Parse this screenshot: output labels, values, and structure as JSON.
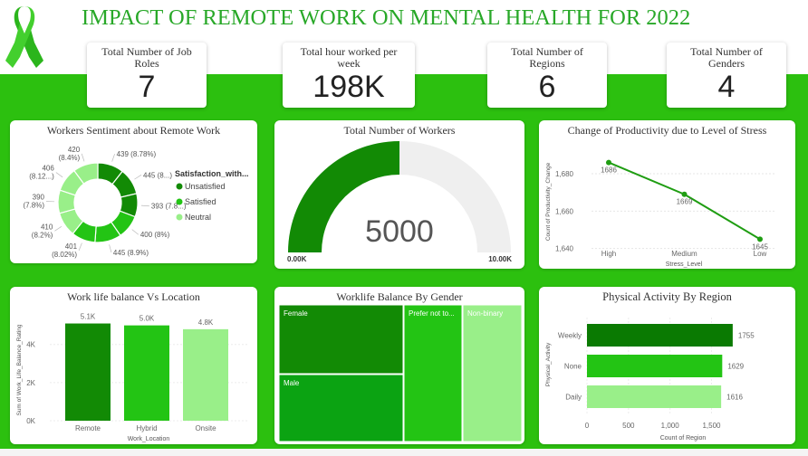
{
  "header": {
    "title": "IMPACT OF REMOTE WORK ON MENTAL HEALTH FOR 2022",
    "ribbon_icon": "awareness-ribbon-icon"
  },
  "kpis": [
    {
      "label": "Total Number of Job Roles",
      "value": "7"
    },
    {
      "label": "Total hour worked per week",
      "value": "198K"
    },
    {
      "label": "Total Number of Regions",
      "value": "6"
    },
    {
      "label": "Total Number of Genders",
      "value": "4"
    }
  ],
  "colors": {
    "dark": "#128a05",
    "mid": "#23c414",
    "light": "#99ef89",
    "darkest": "#0a7a02",
    "line": "#1f9d12",
    "background": "#2cc00f"
  },
  "chart_data": [
    {
      "type": "pie",
      "title": "Workers Sentiment about Remote Work",
      "legend_title": "Satisfaction_with...",
      "legend": [
        "Unsatisfied",
        "Satisfied",
        "Neutral"
      ],
      "slices": [
        {
          "category": "Unsatisfied",
          "value": 439,
          "label": "439 (8.78%)"
        },
        {
          "category": "Unsatisfied",
          "value": 445,
          "label": "445 (8...)"
        },
        {
          "category": "Unsatisfied",
          "value": 393,
          "label": "393 (7.8...)"
        },
        {
          "category": "Satisfied",
          "value": 400,
          "label": "400 (8%)"
        },
        {
          "category": "Satisfied",
          "value": 445,
          "label": "445 (8.9%)"
        },
        {
          "category": "Satisfied",
          "value": 401,
          "label": "401 (8.02%)"
        },
        {
          "category": "Neutral",
          "value": 410,
          "label": "410 (8.2%)"
        },
        {
          "category": "Neutral",
          "value": 390,
          "label": "390 (7.8%)"
        },
        {
          "category": "Neutral",
          "value": 406,
          "label": "406 (8.12...)"
        },
        {
          "category": "Neutral",
          "value": 420,
          "label": "420 (8.4%)"
        }
      ]
    },
    {
      "type": "gauge",
      "title": "Total Number of Workers",
      "value": 5000,
      "value_label": "5000",
      "min": 0,
      "max": 10000,
      "min_label": "0.00K",
      "max_label": "10.00K"
    },
    {
      "type": "line",
      "title": "Change of Productivity due to Level of Stress",
      "categories": [
        "High",
        "Medium",
        "Low"
      ],
      "values": [
        1686,
        1669,
        1645
      ],
      "xlabel": "Stress_Level",
      "ylabel": "Count of Productivity_Change",
      "ylim": [
        1635,
        1695
      ],
      "yticks": [
        1640,
        1660,
        1680
      ],
      "ytick_labels": [
        "1,640",
        "1,660",
        "1,680"
      ]
    },
    {
      "type": "bar",
      "title": "Work life balance Vs Location",
      "categories": [
        "Remote",
        "Hybrid",
        "Onsite"
      ],
      "values": [
        5100,
        5000,
        4800
      ],
      "value_labels": [
        "5.1K",
        "5.0K",
        "4.8K"
      ],
      "xlabel": "Work_Location",
      "ylabel": "Sum of Work_Life_Balance_Rating",
      "ylim": [
        0,
        5600
      ],
      "yticks": [
        0,
        2000,
        4000
      ],
      "ytick_labels": [
        "0K",
        "2K",
        "4K"
      ]
    },
    {
      "type": "treemap",
      "title": "Worklife Balance By Gender",
      "items": [
        {
          "label": "Female"
        },
        {
          "label": "Male"
        },
        {
          "label": "Prefer not to..."
        },
        {
          "label": "Non-binary"
        }
      ]
    },
    {
      "type": "bar",
      "orientation": "horizontal",
      "title": "Physical Activity By Region",
      "categories": [
        "Weekly",
        "None",
        "Daily"
      ],
      "values": [
        1755,
        1629,
        1616
      ],
      "value_labels": [
        "1755",
        "1629",
        "1616"
      ],
      "xlabel": "Count of Region",
      "ylabel": "Physical_Activity",
      "xlim": [
        0,
        1800
      ],
      "xticks": [
        0,
        500,
        1000,
        1500
      ],
      "xtick_labels": [
        "0",
        "500",
        "1,000",
        "1,500"
      ]
    }
  ]
}
